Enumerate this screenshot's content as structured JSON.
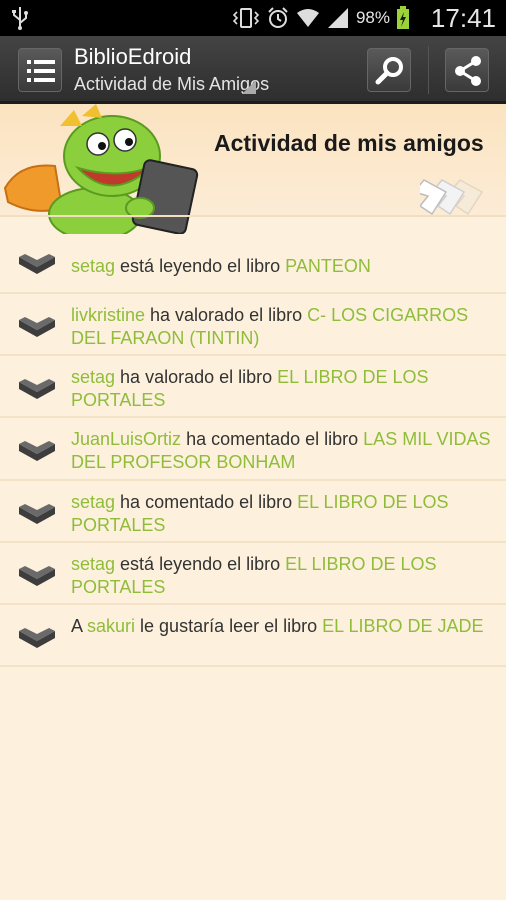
{
  "status_bar": {
    "battery_percent": "98%",
    "time": "17:41"
  },
  "action_bar": {
    "title": "BiblioEdroid",
    "subtitle": "Actividad de Mis Amigos"
  },
  "header": {
    "title": "Actividad de mis amigos"
  },
  "colors": {
    "accent_green": "#8fbd3a",
    "background": "#fdf1de",
    "action_bar": "#363636"
  },
  "activities": [
    {
      "pre": "",
      "user": "setag",
      "action": " está leyendo el libro ",
      "book": "PANTEON"
    },
    {
      "pre": "",
      "user": "livkristine",
      "action": " ha valorado el libro ",
      "book": "C- LOS CIGARROS DEL FARAON (TINTIN)"
    },
    {
      "pre": "",
      "user": "setag",
      "action": " ha valorado el libro ",
      "book": "EL LIBRO DE LOS PORTALES"
    },
    {
      "pre": "",
      "user": "JuanLuisOrtiz",
      "action": " ha comentado el libro ",
      "book": "LAS MIL VIDAS DEL PROFESOR BONHAM"
    },
    {
      "pre": "",
      "user": "setag",
      "action": " ha comentado el libro ",
      "book": "EL LIBRO DE LOS PORTALES"
    },
    {
      "pre": "",
      "user": "setag",
      "action": " está leyendo el libro ",
      "book": "EL LIBRO DE LOS PORTALES"
    },
    {
      "pre": "A ",
      "user": "sakuri",
      "action": " le gustaría leer el libro ",
      "book": "EL LIBRO DE JADE"
    }
  ]
}
